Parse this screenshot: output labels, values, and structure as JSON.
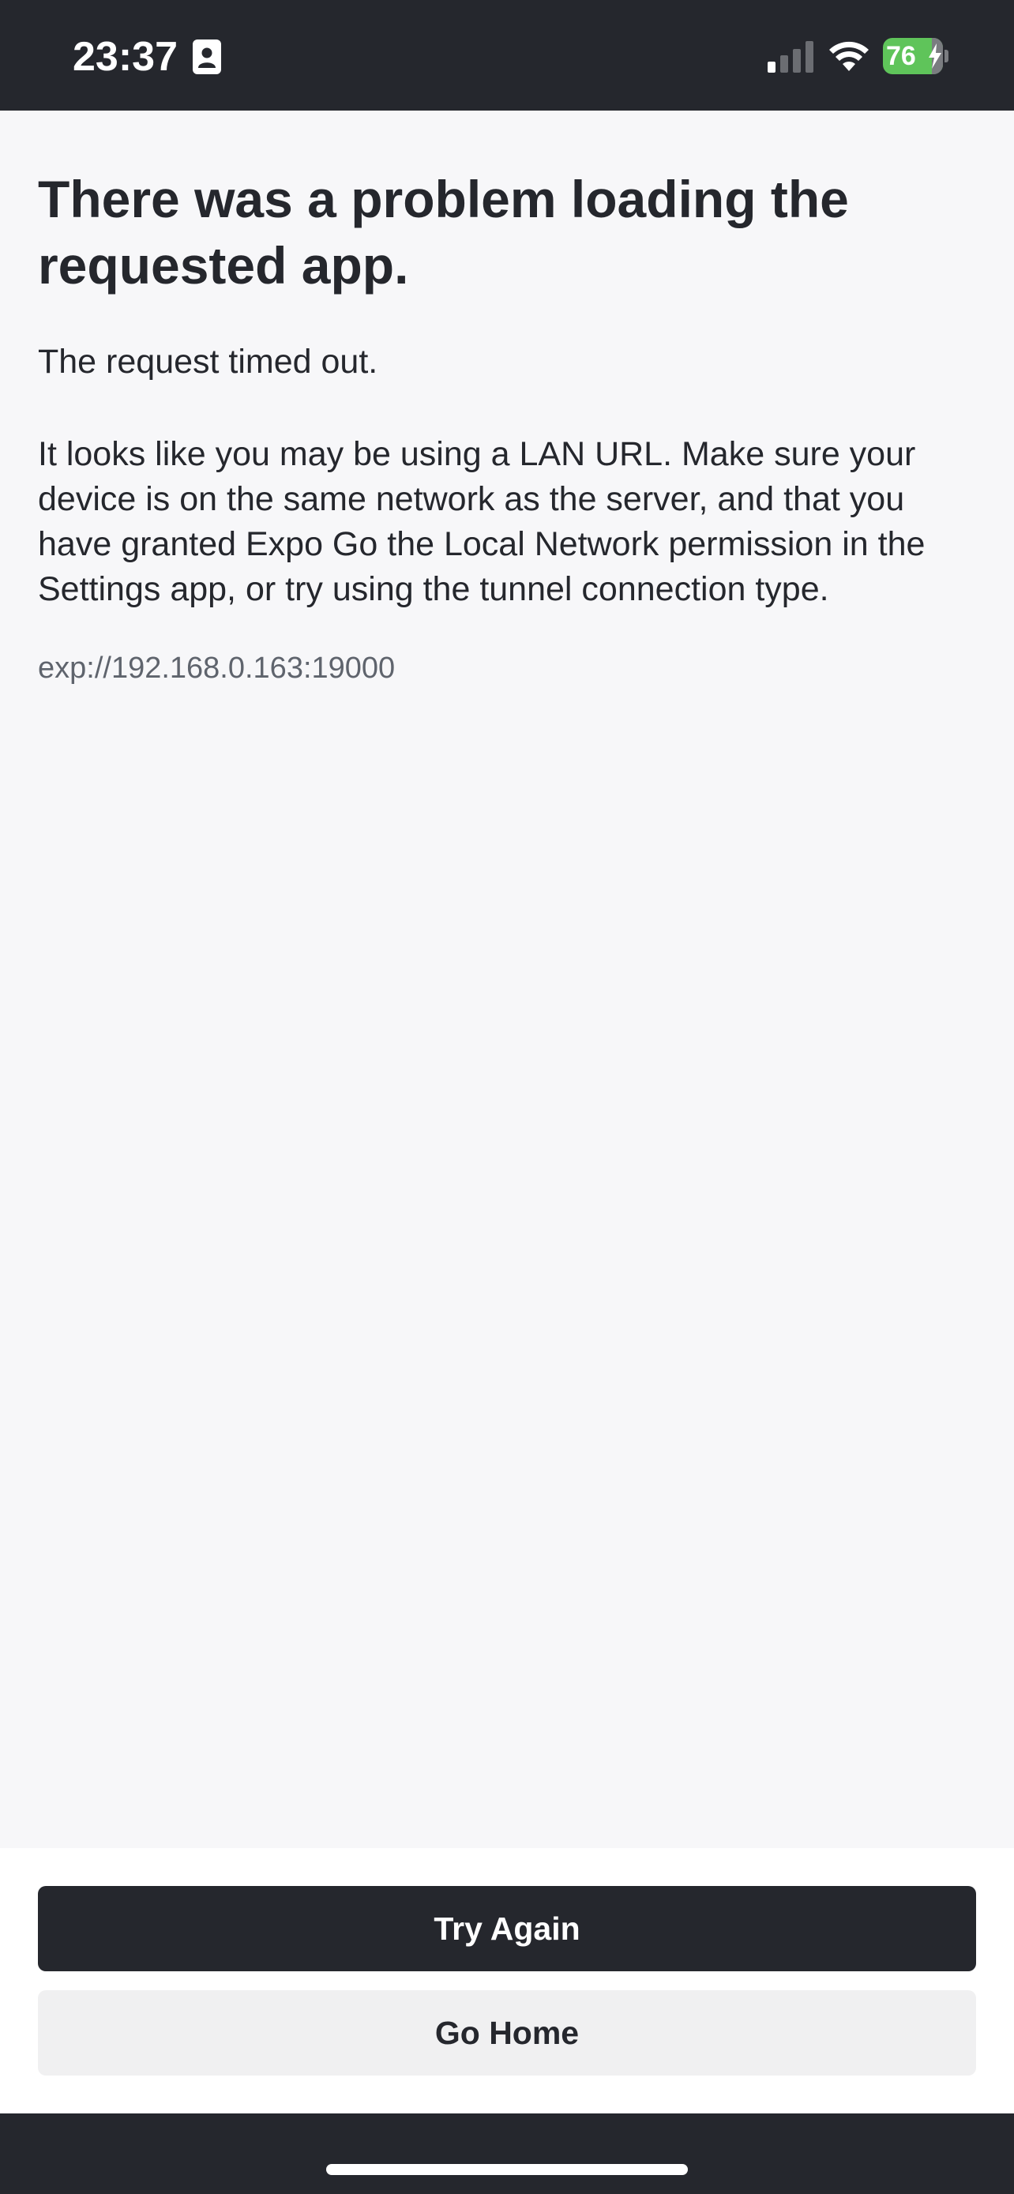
{
  "status_bar": {
    "time": "23:37",
    "battery_level": "76",
    "battery_charging": true,
    "signal_bars_active": 1,
    "signal_bars_total": 4,
    "icons": [
      "contact-badge-icon",
      "cellular-signal-icon",
      "wifi-icon",
      "battery-icon",
      "charging-bolt-icon"
    ]
  },
  "error": {
    "title": "There was a problem loading the requested app.",
    "message": "The request timed out.",
    "hint": "It looks like you may be using a LAN URL. Make sure your device is on the same network as the server, and that you have granted Expo Go the Local Network permission in the Settings app, or try using the tunnel connection type.",
    "url": "exp://192.168.0.163:19000"
  },
  "actions": {
    "try_again_label": "Try Again",
    "go_home_label": "Go Home"
  },
  "colors": {
    "dark": "#25272d",
    "background": "#f7f7f9",
    "secondary_button": "#f0f0f1",
    "muted_text": "#5f646d",
    "battery_green": "#5fc45a"
  }
}
